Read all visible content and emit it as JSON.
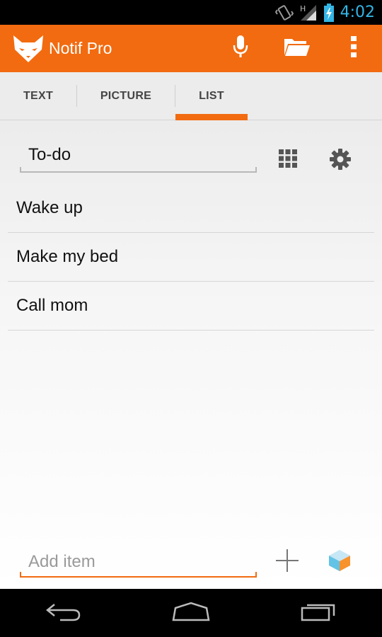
{
  "status_bar": {
    "network_label": "H",
    "time": "4:02"
  },
  "action_bar": {
    "title": "Notif Pro",
    "icons": [
      "fox-logo-icon",
      "microphone-icon",
      "folder-open-icon",
      "overflow-menu-icon"
    ]
  },
  "tabs": [
    {
      "label": "TEXT",
      "active": false
    },
    {
      "label": "PICTURE",
      "active": false
    },
    {
      "label": "LIST",
      "active": true
    }
  ],
  "list_editor": {
    "title_value": "To-do",
    "items": [
      {
        "text": "Wake up"
      },
      {
        "text": "Make my bed"
      },
      {
        "text": "Call mom"
      }
    ],
    "add_placeholder": "Add item"
  },
  "colors": {
    "accent": "#f26b10",
    "clock": "#33b5e5",
    "status_bar": "#000000"
  }
}
